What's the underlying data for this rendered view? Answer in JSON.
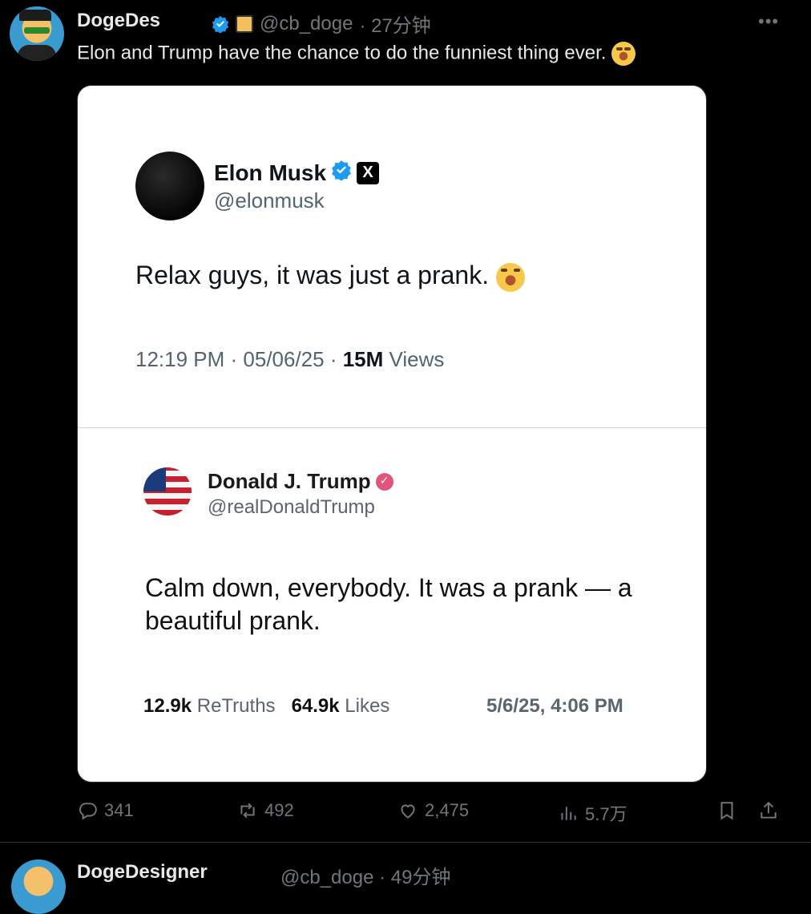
{
  "post": {
    "author_name": "DogeDes",
    "handle": "@cb_doge",
    "time": "· 27分钟",
    "text": "Elon and Trump have the chance to do the funniest thing ever.",
    "more_label": "•••",
    "metrics": {
      "replies": "341",
      "reposts": "492",
      "likes": "2,475",
      "views": "5.7万"
    }
  },
  "musk_card": {
    "name": "Elon Musk",
    "x_label": "X",
    "handle": "@elonmusk",
    "text": "Relax guys, it was just a prank.",
    "time": "12:19 PM · 05/06/25 ·",
    "views_count": "15M",
    "views_label": "Views"
  },
  "trump_card": {
    "name": "Donald J. Trump",
    "handle": "@realDonaldTrump",
    "text": "Calm down, everybody. It was a prank — a beautiful prank.",
    "retruths_count": "12.9k",
    "retruths_label": "ReTruths",
    "likes_count": "64.9k",
    "likes_label": "Likes",
    "date": "5/6/25, 4:06 PM"
  },
  "next_post": {
    "author_name": "DogeDesigner",
    "meta": "@cb_doge · 49分钟"
  },
  "colors": {
    "verified_blue": "#1d9bf0",
    "truth_pink": "#e2557a"
  }
}
